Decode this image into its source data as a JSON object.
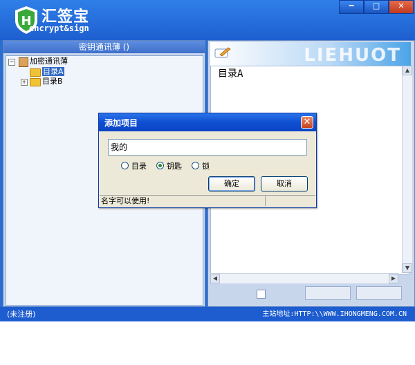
{
  "app": {
    "brand_cn": "汇签宝",
    "brand_en": "encrypt&sign",
    "window_buttons": {
      "minimize": "━",
      "maximize": "□",
      "close": "✕"
    }
  },
  "left_panel": {
    "header": "密钥通讯薄 ()",
    "tree": {
      "root": {
        "label": "加密通讯薄",
        "expander": "−"
      },
      "children": [
        {
          "label": "目录A",
          "expander": "",
          "selected": true
        },
        {
          "label": "目录B",
          "expander": "+",
          "selected": false
        }
      ]
    }
  },
  "right_panel": {
    "watermark": "LIEHUOT",
    "content_text": "目录A",
    "scroll_up": "▲",
    "scroll_down": "▼",
    "scroll_left": "◀",
    "scroll_right": "▶"
  },
  "dialog": {
    "title": "添加项目",
    "close_glyph": "✕",
    "input_value": "我的",
    "radio_options": [
      {
        "label": "目录",
        "checked": false
      },
      {
        "label": "钥匙",
        "checked": true
      },
      {
        "label": "锁",
        "checked": false
      }
    ],
    "ok_label": "确定",
    "cancel_label": "取消",
    "status_text": "名字可以使用!"
  },
  "statusbar": {
    "left": "(未注册)",
    "right": "主站地址:HTTP:\\\\WWW.IHONGMENG.COM.CN"
  },
  "colors": {
    "titlebar": "#1e5fd0",
    "panel": "#c8d6ec",
    "dialog_title": "#0f4fd2",
    "selection": "#316ac5"
  }
}
